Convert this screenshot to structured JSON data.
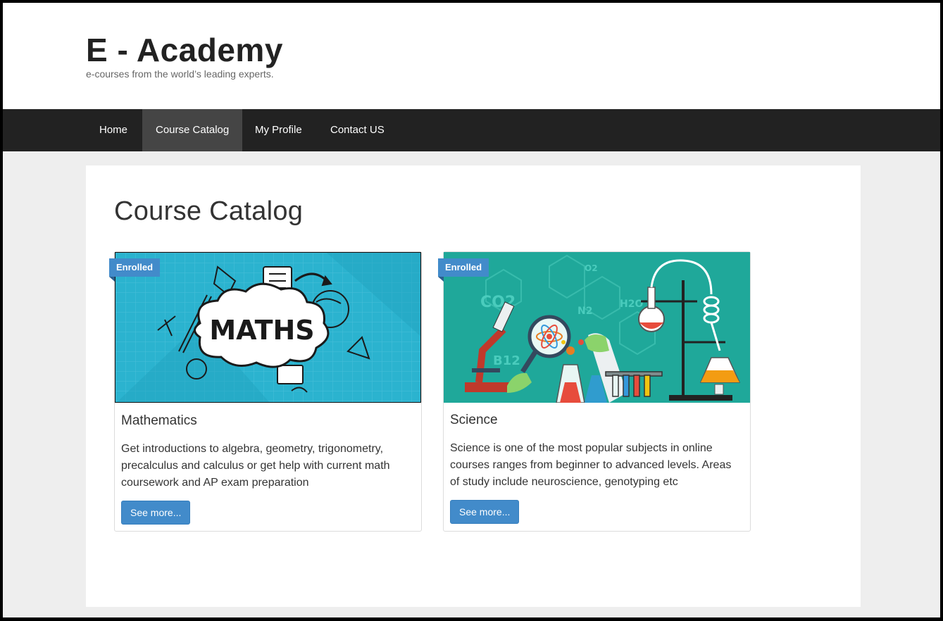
{
  "site": {
    "title": "E - Academy",
    "tagline": "e-courses from the world’s leading experts."
  },
  "nav": {
    "items": [
      {
        "label": "Home",
        "active": false
      },
      {
        "label": "Course Catalog",
        "active": true
      },
      {
        "label": "My Profile",
        "active": false
      },
      {
        "label": "Contact US",
        "active": false
      }
    ]
  },
  "page": {
    "title": "Course Catalog"
  },
  "courses": [
    {
      "badge": "Enrolled",
      "image_text": "MATHS",
      "image_icon": "maths-illustration",
      "title": "Mathematics",
      "description": "Get introductions to algebra, geometry, trigonometry, precalculus and calculus or get help with current math coursework and AP exam preparation",
      "button": "See more..."
    },
    {
      "badge": "Enrolled",
      "image_icon": "science-lab-illustration",
      "image_labels": [
        "CO2",
        "O2",
        "N2",
        "H2O",
        "B12"
      ],
      "title": "Science",
      "description": "Science is one of the most popular subjects in online courses ranges from beginner to advanced levels. Areas of study include neuroscience, genotyping etc",
      "button": "See more..."
    }
  ],
  "colors": {
    "nav_bg": "#222222",
    "nav_active": "#454545",
    "accent": "#428bca",
    "maths_bg": "#2bb3cf",
    "science_bg": "#1fa89a"
  }
}
